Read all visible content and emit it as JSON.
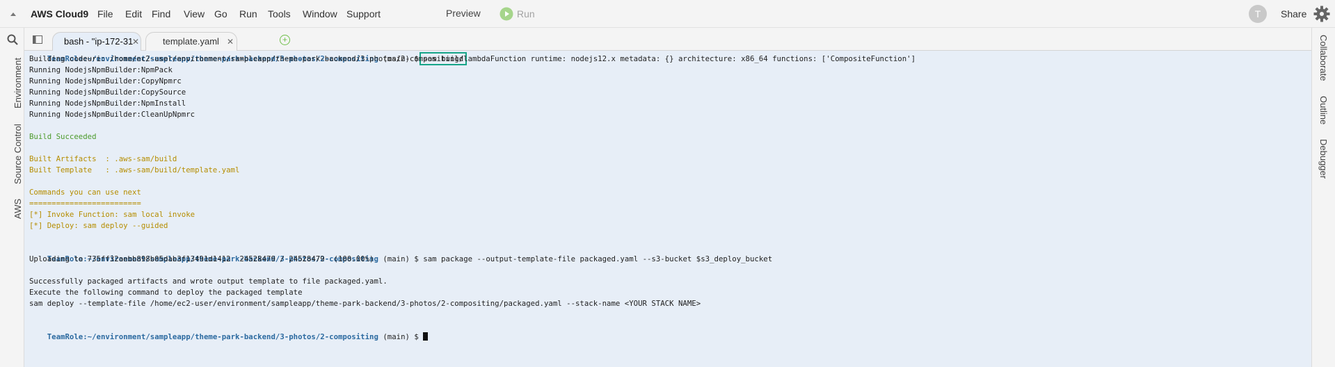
{
  "menubar": {
    "brand": "AWS Cloud9",
    "items": [
      "File",
      "Edit",
      "Find",
      "View",
      "Go",
      "Run",
      "Tools",
      "Window",
      "Support"
    ],
    "preview": "Preview",
    "run": "Run",
    "avatar_letter": "T",
    "share": "Share"
  },
  "leftbar": {
    "tabs": [
      "Environment",
      "Source Control",
      "AWS"
    ]
  },
  "rightbar": {
    "tabs": [
      "Collaborate",
      "Outline",
      "Debugger"
    ]
  },
  "tabs": [
    {
      "label": "bash - \"ip-172-31",
      "active": true
    },
    {
      "label": "template.yaml",
      "active": false
    }
  ],
  "terminal": {
    "prompt": {
      "role": "TeamRole:",
      "path": "~/environment/sampleapp/theme-park-backend/3-photos/2-compositing",
      "branch": " (main) $ "
    },
    "cmd1": "sam build",
    "lines1": [
      "Building codeuri: /home/ec2-user/environment/sampleapp/theme-park-backend/3-photos/2-compositing/lambdaFunction runtime: nodejs12.x metadata: {} architecture: x86_64 functions: ['CompositeFunction']",
      "Running NodejsNpmBuilder:NpmPack",
      "Running NodejsNpmBuilder:CopyNpmrc",
      "Running NodejsNpmBuilder:CopySource",
      "Running NodejsNpmBuilder:NpmInstall",
      "Running NodejsNpmBuilder:CleanUpNpmrc"
    ],
    "build_succeeded": "Build Succeeded",
    "artifacts": [
      "Built Artifacts  : .aws-sam/build",
      "Built Template   : .aws-sam/build/template.yaml"
    ],
    "next_cmds": [
      "Commands you can use next",
      "=========================",
      "[*] Invoke Function: sam local invoke",
      "[*] Deploy: sam deploy --guided"
    ],
    "cmd2": "sam package --output-template-file packaged.yaml --s3-bucket $s3_deploy_bucket",
    "upload": "Uploading to 735ff32aebb898b05dab3f13491d1412  24528479 / 24528479  (100.00%)",
    "lines2": [
      "Successfully packaged artifacts and wrote output template to file packaged.yaml.",
      "Execute the following command to deploy the packaged template",
      "sam deploy --template-file /home/ec2-user/environment/sampleapp/theme-park-backend/3-photos/2-compositing/packaged.yaml --stack-name <YOUR STACK NAME>"
    ]
  }
}
